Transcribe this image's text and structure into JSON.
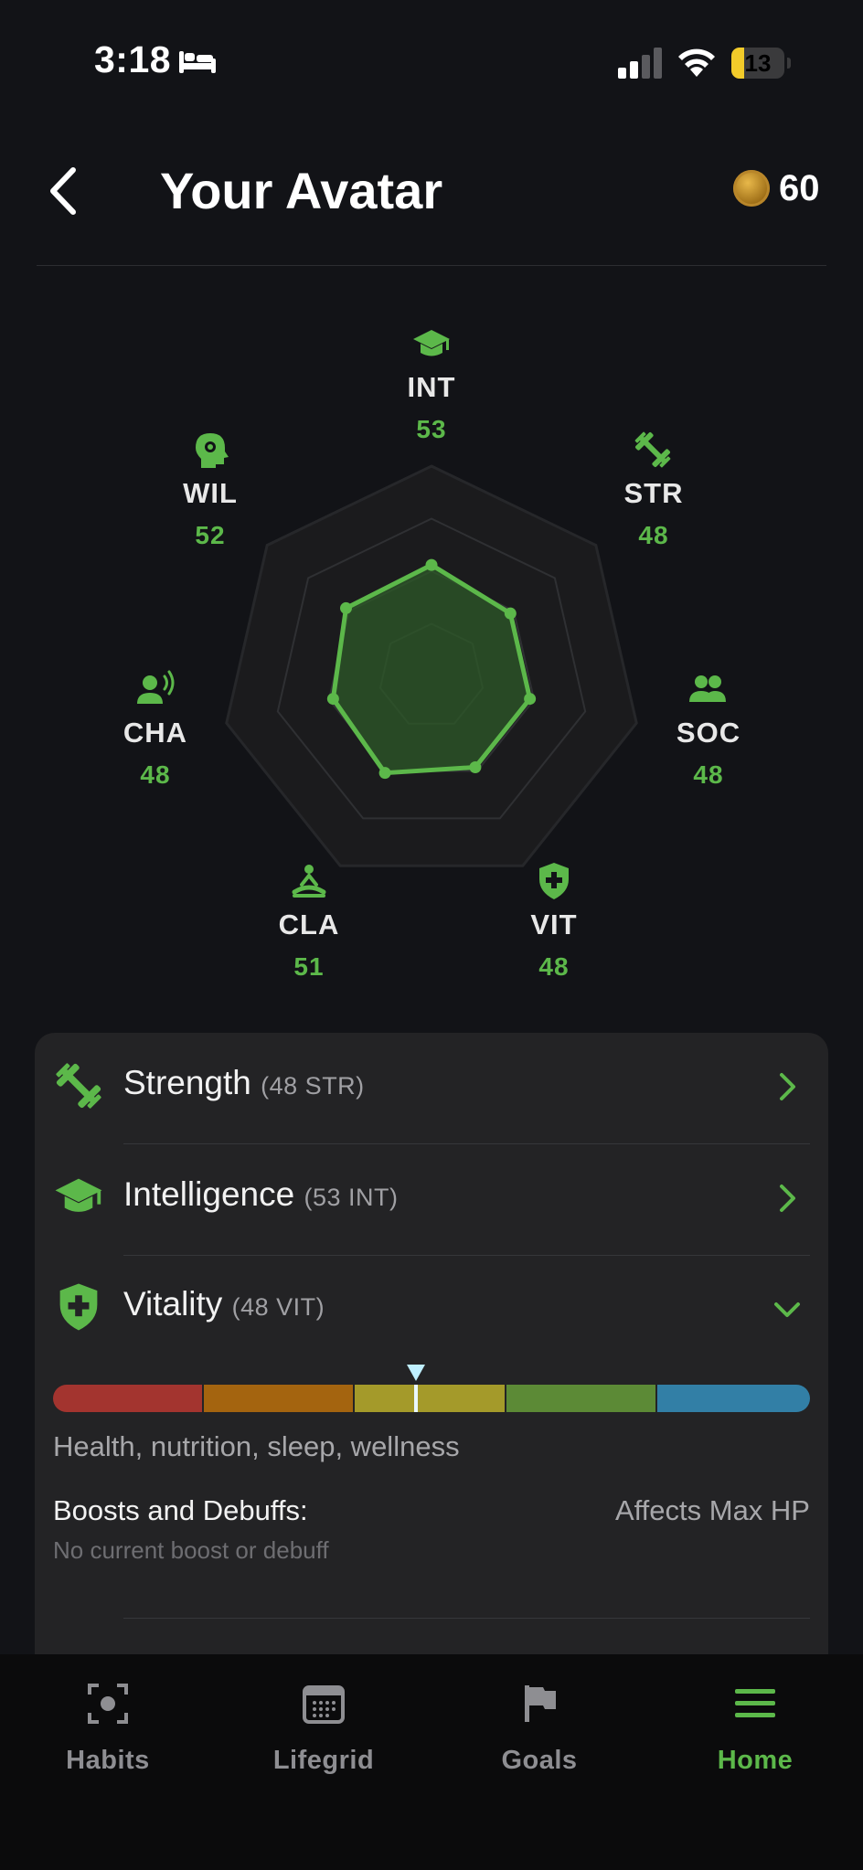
{
  "status_bar": {
    "time": "3:18",
    "battery": "13",
    "icons": [
      "bed-icon",
      "signal-icon",
      "wifi-icon",
      "battery-icon"
    ]
  },
  "header": {
    "title": "Your Avatar",
    "coins": "60",
    "back_icon": "chevron-left-icon",
    "coin_icon": "gold-coin-icon"
  },
  "colors": {
    "background": "#121317",
    "card": "#232325",
    "accent_green": "#5cb84a",
    "radar_fill": "#2e5a28",
    "meter": [
      "#a3342f",
      "#a4640f",
      "#a49a2a",
      "#5c8a36",
      "#327fa6"
    ],
    "marker": "#bfefff"
  },
  "radar": {
    "max": 100,
    "stats": [
      {
        "key": "INT",
        "value": 53,
        "icon": "graduation-cap-icon"
      },
      {
        "key": "STR",
        "value": 48,
        "icon": "dumbbell-icon"
      },
      {
        "key": "SOC",
        "value": 48,
        "icon": "people-icon"
      },
      {
        "key": "VIT",
        "value": 48,
        "icon": "shield-plus-icon"
      },
      {
        "key": "CLA",
        "value": 51,
        "icon": "meditation-icon"
      },
      {
        "key": "CHA",
        "value": 48,
        "icon": "speaking-person-icon"
      },
      {
        "key": "WIL",
        "value": 52,
        "icon": "head-gear-icon"
      }
    ]
  },
  "attributes": [
    {
      "name": "Strength",
      "sub": "(48 STR)",
      "icon": "dumbbell-icon",
      "expanded": false
    },
    {
      "name": "Intelligence",
      "sub": "(53 INT)",
      "icon": "graduation-cap-icon",
      "expanded": false
    },
    {
      "name": "Vitality",
      "sub": "(48 VIT)",
      "icon": "shield-plus-icon",
      "expanded": true
    }
  ],
  "vitality_detail": {
    "level": 48,
    "description": "Health, nutrition, sleep, wellness",
    "boosts_title": "Boosts and Debuffs:",
    "affects": "Affects Max HP",
    "boost_status": "No current boost or debuff"
  },
  "tabs": [
    {
      "label": "Habits",
      "icon": "focus-target-icon",
      "active": false
    },
    {
      "label": "Lifegrid",
      "icon": "calendar-grid-icon",
      "active": false
    },
    {
      "label": "Goals",
      "icon": "flag-icon",
      "active": false
    },
    {
      "label": "Home",
      "icon": "menu-icon",
      "active": true
    }
  ]
}
